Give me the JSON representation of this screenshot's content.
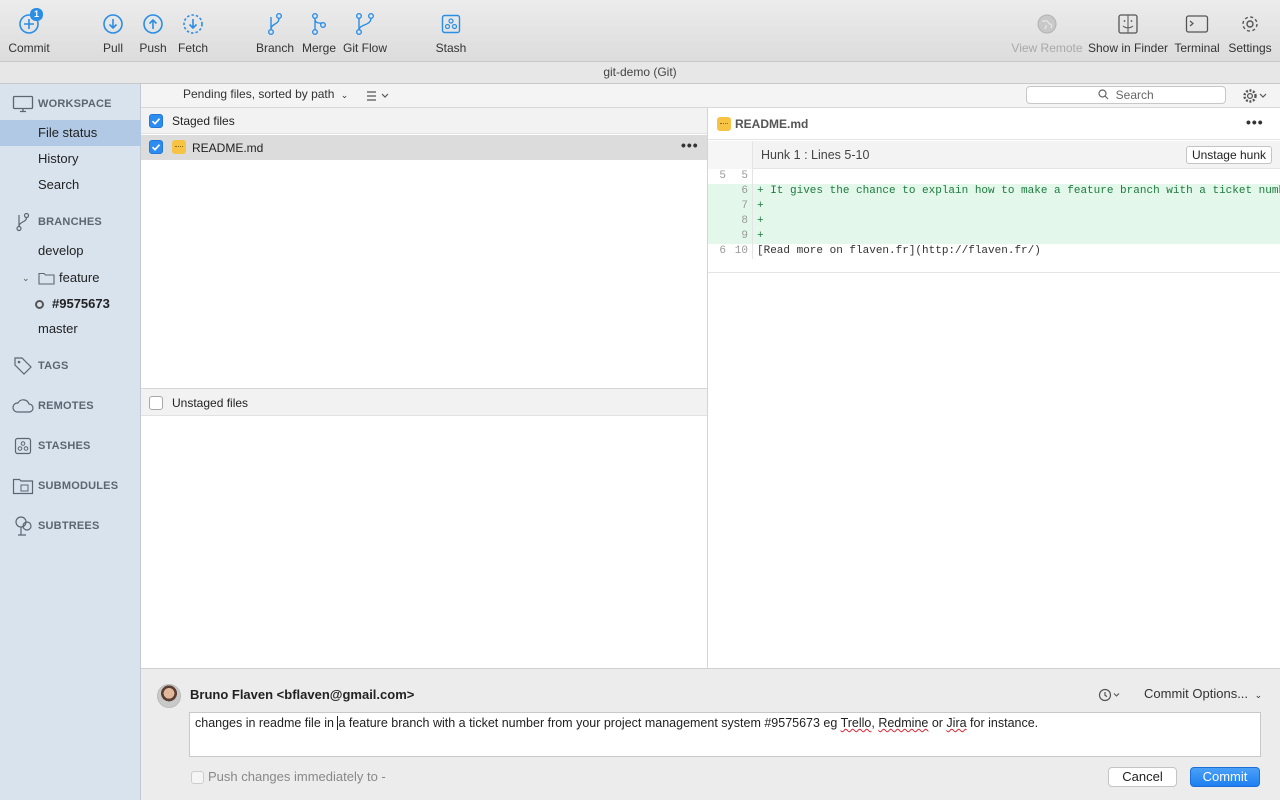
{
  "toolbar": {
    "commit": {
      "label": "Commit",
      "badge": "1"
    },
    "pull": {
      "label": "Pull"
    },
    "push": {
      "label": "Push"
    },
    "fetch": {
      "label": "Fetch"
    },
    "branch": {
      "label": "Branch"
    },
    "merge": {
      "label": "Merge"
    },
    "gitflow": {
      "label": "Git Flow"
    },
    "stash": {
      "label": "Stash"
    },
    "view_remote": {
      "label": "View Remote",
      "disabled": true
    },
    "show_in_finder": {
      "label": "Show in Finder"
    },
    "terminal": {
      "label": "Terminal"
    },
    "settings": {
      "label": "Settings"
    }
  },
  "window": {
    "title": "git-demo (Git)"
  },
  "sidebar": {
    "workspace": {
      "heading": "WORKSPACE",
      "items": [
        "File status",
        "History",
        "Search"
      ],
      "selected": "File status"
    },
    "branches": {
      "heading": "BRANCHES",
      "develop": "develop",
      "feature_folder": "feature",
      "current_branch": "#9575673",
      "master": "master"
    },
    "tags": {
      "heading": "TAGS"
    },
    "remotes": {
      "heading": "REMOTES"
    },
    "stashes": {
      "heading": "STASHES"
    },
    "submodules": {
      "heading": "SUBMODULES"
    },
    "subtrees": {
      "heading": "SUBTREES"
    }
  },
  "filter": {
    "sort_label": "Pending files, sorted by path",
    "search_placeholder": "Search"
  },
  "staged": {
    "header": "Staged files",
    "checked": true,
    "files": [
      {
        "name": "README.md",
        "status": "modified",
        "checked": true
      }
    ]
  },
  "unstaged": {
    "header": "Unstaged files",
    "checked": false
  },
  "diff": {
    "file": "README.md",
    "hunk_title": "Hunk 1 : Lines 5-10",
    "unstage_label": "Unstage hunk",
    "lines": [
      {
        "old": "5",
        "new": "5",
        "type": "context",
        "text": ""
      },
      {
        "old": "",
        "new": "6",
        "type": "add",
        "text": "+ It gives the chance to explain how to make a feature branch with a ticket number from"
      },
      {
        "old": "",
        "new": "7",
        "type": "add",
        "text": "+"
      },
      {
        "old": "",
        "new": "8",
        "type": "add",
        "text": "+"
      },
      {
        "old": "",
        "new": "9",
        "type": "add",
        "text": "+"
      },
      {
        "old": "6",
        "new": "10",
        "type": "context",
        "text": "  [Read more on flaven.fr](http://flaven.fr/)"
      }
    ]
  },
  "commit": {
    "author": "Bruno Flaven <bflaven@gmail.com>",
    "options_label": "Commit Options...",
    "message_parts": {
      "p1": "changes in readme file in ",
      "p2": "a feature branch with a ticket number from your project management system #9575673 eg ",
      "w1": "Trello",
      "p3": ", ",
      "w2": "Redmine",
      "p4": " or ",
      "w3": "Jira",
      "p5": " for instance."
    },
    "push_label": "Push changes immediately to -",
    "cancel_label": "Cancel",
    "commit_label": "Commit"
  },
  "colors": {
    "accent": "#2d8cf0",
    "sidebar_bg": "#d9e3ee",
    "sidebar_selected": "#b1c9e5",
    "diff_add_bg": "#e3f8eb",
    "modified_badge": "#f6c344"
  }
}
